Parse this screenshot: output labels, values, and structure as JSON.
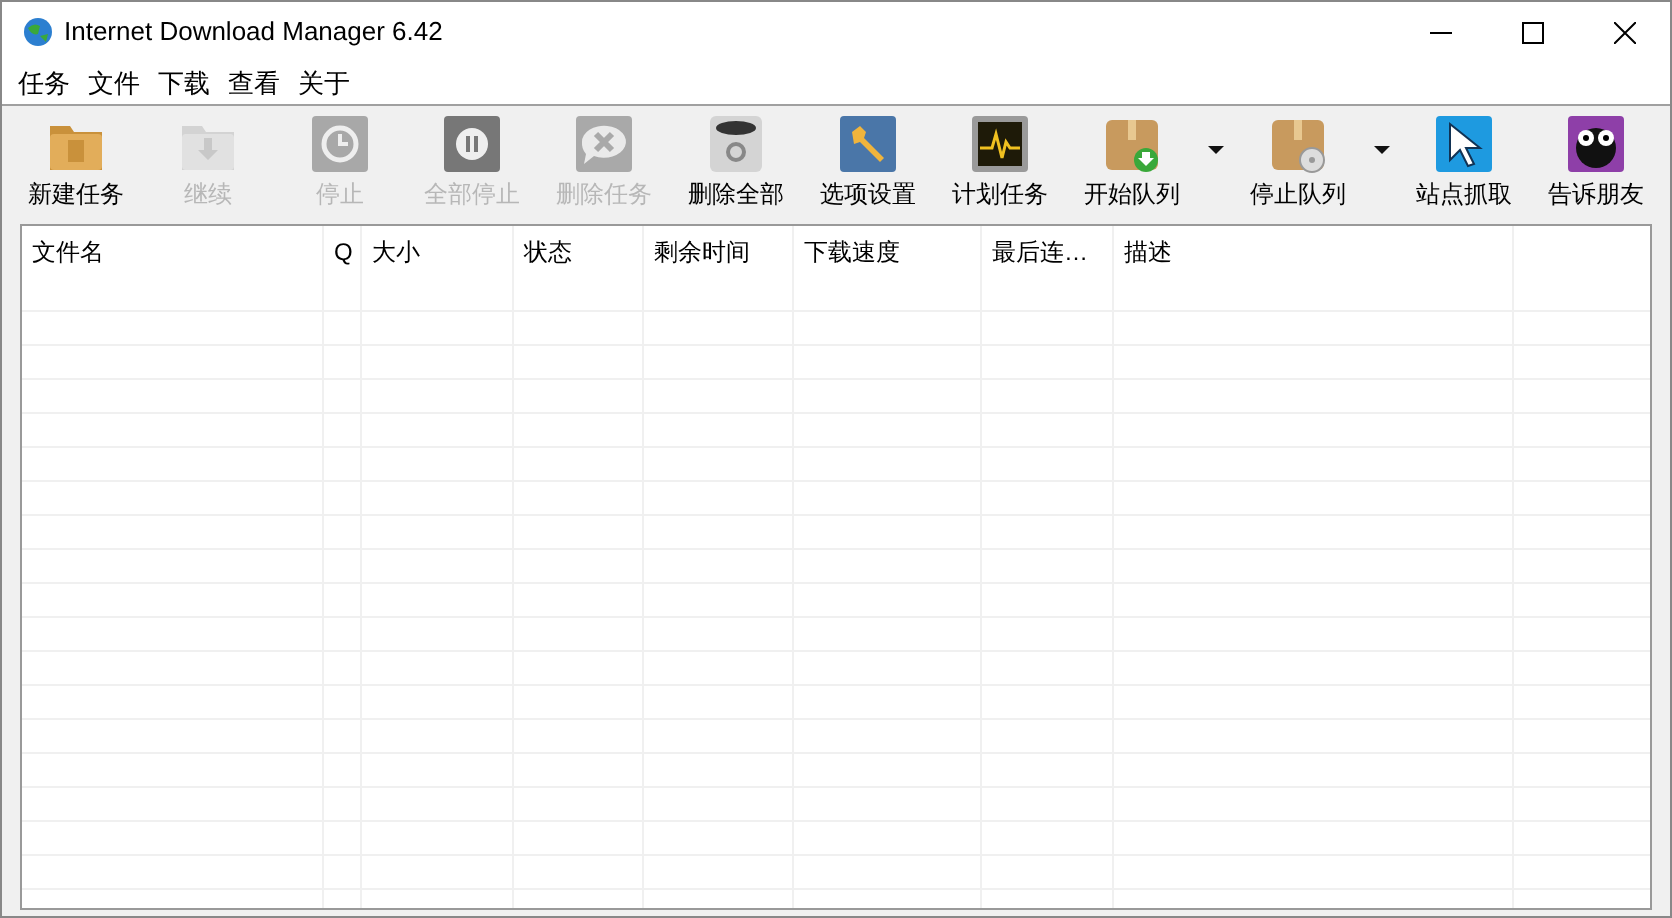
{
  "window": {
    "title": "Internet Download Manager 6.42"
  },
  "menu": [
    "任务",
    "文件",
    "下载",
    "查看",
    "关于"
  ],
  "toolbar": [
    {
      "label": "新建任务",
      "kind": "folder",
      "disabled": false
    },
    {
      "label": "继续",
      "kind": "folder-down",
      "disabled": true
    },
    {
      "label": "停止",
      "kind": "clock",
      "disabled": true
    },
    {
      "label": "全部停止",
      "kind": "pause",
      "disabled": true
    },
    {
      "label": "删除任务",
      "kind": "bubble",
      "disabled": true
    },
    {
      "label": "删除全部",
      "kind": "bin",
      "disabled": false
    },
    {
      "label": "选项设置",
      "kind": "wrench",
      "disabled": false
    },
    {
      "label": "计划任务",
      "kind": "monitor",
      "disabled": false
    },
    {
      "label": "开始队列",
      "kind": "box-start",
      "disabled": false,
      "dropdown": true
    },
    {
      "label": "停止队列",
      "kind": "box-stop",
      "disabled": false,
      "dropdown": true
    },
    {
      "label": "站点抓取",
      "kind": "cursor",
      "disabled": false
    },
    {
      "label": "告诉朋友",
      "kind": "face",
      "disabled": false
    }
  ],
  "table": {
    "columns": [
      "文件名",
      "Q",
      "大小",
      "状态",
      "剩余时间",
      "下载速度",
      "最后连…",
      "描述"
    ]
  }
}
